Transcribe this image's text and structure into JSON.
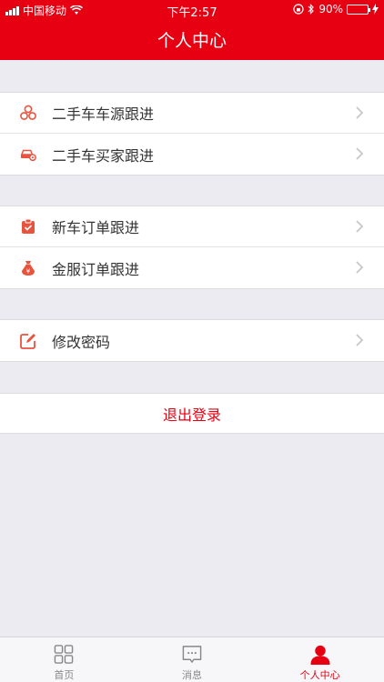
{
  "status": {
    "carrier": "中国移动",
    "time": "下午2:57",
    "battery": "90%",
    "battery_level": 0.9
  },
  "header": {
    "title": "个人中心"
  },
  "groups": [
    {
      "items": [
        {
          "label": "二手车车源跟进",
          "icon": "coins-icon"
        },
        {
          "label": "二手车买家跟进",
          "icon": "car-icon"
        }
      ]
    },
    {
      "items": [
        {
          "label": "新车订单跟进",
          "icon": "clipboard-check-icon"
        },
        {
          "label": "金服订单跟进",
          "icon": "money-bag-icon"
        }
      ]
    },
    {
      "items": [
        {
          "label": "修改密码",
          "icon": "edit-icon"
        }
      ]
    }
  ],
  "logout": {
    "label": "退出登录"
  },
  "tabs": [
    {
      "label": "首页",
      "icon": "grid-icon",
      "active": false
    },
    {
      "label": "消息",
      "icon": "message-icon",
      "active": false
    },
    {
      "label": "个人中心",
      "icon": "person-icon",
      "active": true
    }
  ],
  "colors": {
    "primary": "#e60012",
    "background": "#ebebf1",
    "icon": "#e8533e"
  }
}
